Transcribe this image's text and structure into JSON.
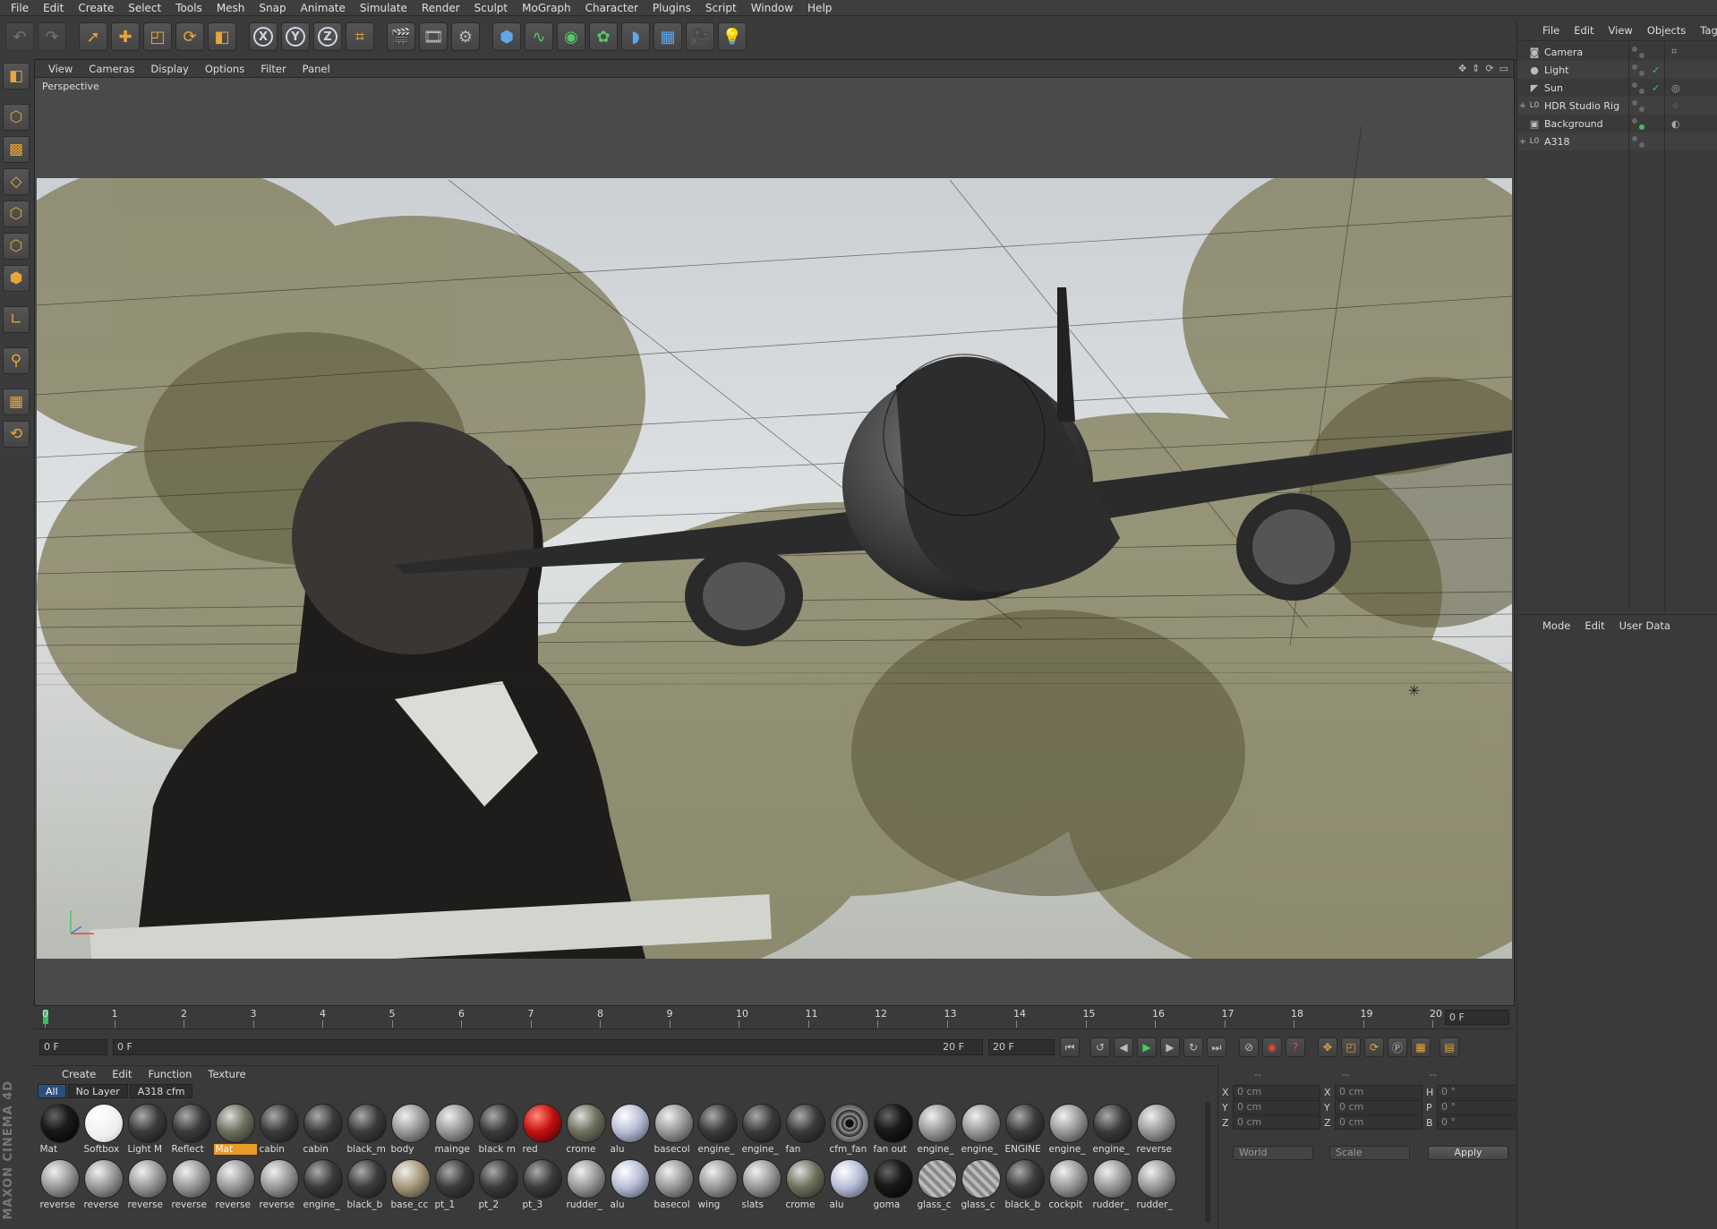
{
  "menubar": [
    "File",
    "Edit",
    "Create",
    "Select",
    "Tools",
    "Mesh",
    "Snap",
    "Animate",
    "Simulate",
    "Render",
    "Sculpt",
    "MoGraph",
    "Character",
    "Plugins",
    "Script",
    "Window",
    "Help"
  ],
  "viewport": {
    "menu": [
      "View",
      "Cameras",
      "Display",
      "Options",
      "Filter",
      "Panel"
    ],
    "label": "Perspective"
  },
  "timeline": {
    "ticks": [
      "0",
      "1",
      "2",
      "3",
      "4",
      "5",
      "6",
      "7",
      "8",
      "9",
      "10",
      "11",
      "12",
      "13",
      "14",
      "15",
      "16",
      "17",
      "18",
      "19",
      "20"
    ],
    "current": "0 F"
  },
  "transport": {
    "start": "0 F",
    "range_start": "0 F",
    "range_end": "20 F",
    "end": "20 F"
  },
  "materials": {
    "menu": [
      "Create",
      "Edit",
      "Function",
      "Texture"
    ],
    "filters": [
      "All",
      "No Layer",
      "A318 cfm"
    ],
    "items": [
      {
        "name": "Mat",
        "style": "black"
      },
      {
        "name": "Softbox",
        "style": "white"
      },
      {
        "name": "Light M",
        "style": "dark"
      },
      {
        "name": "Reflect",
        "style": "dark"
      },
      {
        "name": "Mat",
        "style": "env"
      },
      {
        "name": "cabin",
        "style": "dark"
      },
      {
        "name": "cabin",
        "style": "dark"
      },
      {
        "name": "black_m",
        "style": "dark"
      },
      {
        "name": "body",
        "style": "plain"
      },
      {
        "name": "mainge",
        "style": "plain"
      },
      {
        "name": "black m",
        "style": "dark"
      },
      {
        "name": "red",
        "style": "red"
      },
      {
        "name": "crome",
        "style": "env"
      },
      {
        "name": "alu",
        "style": "blue"
      },
      {
        "name": "basecol",
        "style": "plain"
      },
      {
        "name": "engine_",
        "style": "dark"
      },
      {
        "name": "engine_",
        "style": "dark"
      },
      {
        "name": "fan",
        "style": "dark"
      },
      {
        "name": "cfm_fan",
        "style": "swirl"
      },
      {
        "name": "fan out",
        "style": "black"
      },
      {
        "name": "engine_",
        "style": "plain"
      },
      {
        "name": "engine_",
        "style": "plain"
      },
      {
        "name": "ENGINE",
        "style": "dark"
      },
      {
        "name": "engine_",
        "style": "plain"
      },
      {
        "name": "engine_",
        "style": "dark"
      },
      {
        "name": "reverse",
        "style": "plain"
      },
      {
        "name": "reverse",
        "style": "plain"
      },
      {
        "name": "reverse",
        "style": "plain"
      },
      {
        "name": "reverse",
        "style": "plain"
      },
      {
        "name": "reverse",
        "style": "plain"
      },
      {
        "name": "reverse",
        "style": "plain"
      },
      {
        "name": "reverse",
        "style": "plain"
      },
      {
        "name": "engine_",
        "style": "dark"
      },
      {
        "name": "black_b",
        "style": "dark"
      },
      {
        "name": "base_cc",
        "style": "tan"
      },
      {
        "name": "pt_1",
        "style": "dark"
      },
      {
        "name": "pt_2",
        "style": "dark"
      },
      {
        "name": "pt_3",
        "style": "dark"
      },
      {
        "name": "rudder_",
        "style": "plain"
      },
      {
        "name": "alu",
        "style": "blue"
      },
      {
        "name": "basecol",
        "style": "plain"
      },
      {
        "name": "wing",
        "style": "plain"
      },
      {
        "name": "slats",
        "style": "plain"
      },
      {
        "name": "crome",
        "style": "env"
      },
      {
        "name": "alu",
        "style": "blue"
      },
      {
        "name": "goma",
        "style": "black"
      },
      {
        "name": "glass_c",
        "style": "hatch"
      },
      {
        "name": "glass_c",
        "style": "hatch"
      },
      {
        "name": "black_b",
        "style": "dark"
      },
      {
        "name": "cockpit",
        "style": "plain"
      },
      {
        "name": "rudder_",
        "style": "plain"
      },
      {
        "name": "rudder_",
        "style": "plain"
      }
    ],
    "selected_index": 4
  },
  "coordinates": {
    "headers": [
      "--",
      "--",
      "--"
    ],
    "rows": [
      {
        "a": "X",
        "av": "0 cm",
        "b": "X",
        "bv": "0 cm",
        "c": "H",
        "cv": "0 °"
      },
      {
        "a": "Y",
        "av": "0 cm",
        "b": "Y",
        "bv": "0 cm",
        "c": "P",
        "cv": "0 °"
      },
      {
        "a": "Z",
        "av": "0 cm",
        "b": "Z",
        "bv": "0 cm",
        "c": "B",
        "cv": "0 °"
      }
    ],
    "space": "World",
    "mode": "Scale",
    "apply": "Apply"
  },
  "objects": {
    "menu": [
      "File",
      "Edit",
      "View",
      "Objects",
      "Tags"
    ],
    "items": [
      {
        "name": "Camera",
        "icon": "camera-icon",
        "expand": ""
      },
      {
        "name": "Light",
        "icon": "light-icon",
        "expand": ""
      },
      {
        "name": "Sun",
        "icon": "sun-icon",
        "expand": ""
      },
      {
        "name": "HDR Studio Rig",
        "icon": "null-icon",
        "expand": "+"
      },
      {
        "name": "Background",
        "icon": "background-icon",
        "expand": ""
      },
      {
        "name": "A318",
        "icon": "null-icon",
        "expand": "+"
      }
    ]
  },
  "attributes": {
    "menu": [
      "Mode",
      "Edit",
      "User Data"
    ]
  },
  "brand": "MAXON CINEMA 4D"
}
